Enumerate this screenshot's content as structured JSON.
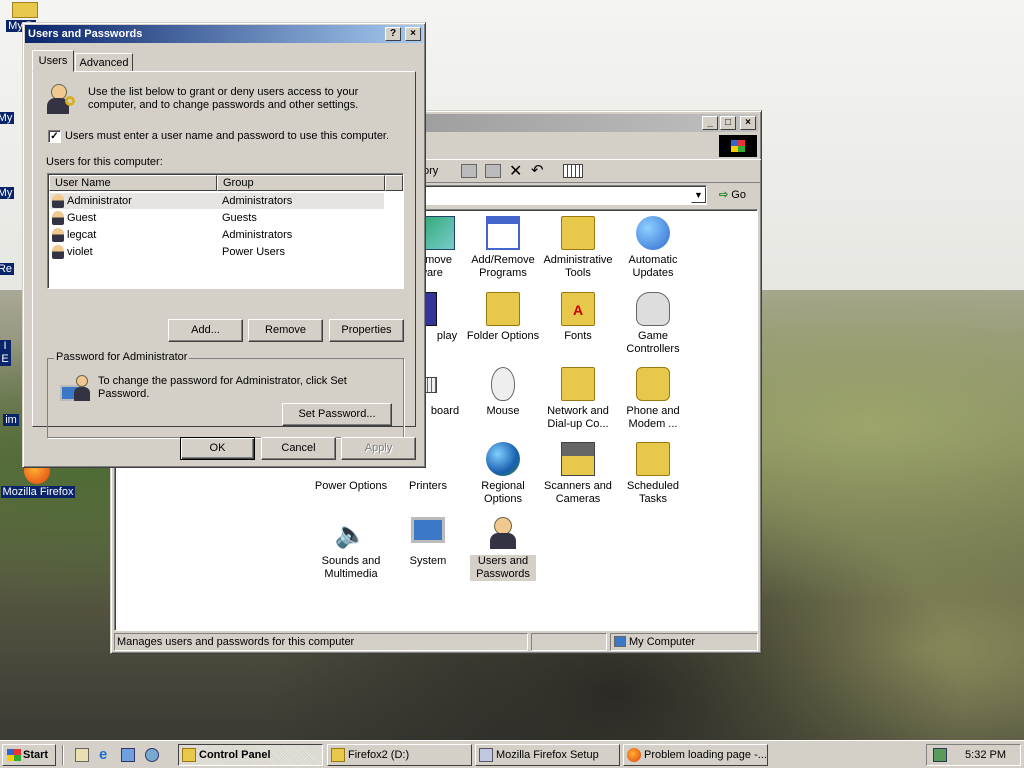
{
  "desktop": {
    "icons": [
      {
        "label": "My D"
      },
      {
        "label": "My"
      },
      {
        "label": "My"
      },
      {
        "label": "Re"
      },
      {
        "label": "I E"
      },
      {
        "label": "im"
      },
      {
        "label": "Mozilla Firefox"
      }
    ]
  },
  "control_panel": {
    "toolbar_history": "ory",
    "go_label": "Go",
    "icons": [
      {
        "label": "emove\nware",
        "color": "#3a7"
      },
      {
        "label": "Add/Remove Programs",
        "color": "#4466cc"
      },
      {
        "label": "Administrative Tools",
        "color": "#e8c84a"
      },
      {
        "label": "Automatic Updates",
        "color": "#2f6ad0"
      },
      {
        "label": "play",
        "color": "#333399"
      },
      {
        "label": "Folder Options",
        "color": "#e8c84a"
      },
      {
        "label": "Fonts",
        "color": "#e8c84a"
      },
      {
        "label": "Game Controllers",
        "color": "#999999"
      },
      {
        "label": "board",
        "color": "#999999"
      },
      {
        "label": "Mouse",
        "color": "#dddddd"
      },
      {
        "label": "Network and Dial-up Co...",
        "color": "#e8c84a"
      },
      {
        "label": "Phone and Modem ...",
        "color": "#e8c84a"
      },
      {
        "label": "Power Options",
        "color": "#e8c84a"
      },
      {
        "label": "Printers",
        "color": "#aaaaaa"
      },
      {
        "label": "Regional Options",
        "color": "#2d8a3e"
      },
      {
        "label": "Scanners and Cameras",
        "color": "#888888"
      },
      {
        "label": "Scheduled Tasks",
        "color": "#e8c84a"
      },
      {
        "label": "Sounds and Multimedia",
        "color": "#cccccc"
      },
      {
        "label": "System",
        "color": "#3c78c8"
      },
      {
        "label": "Users and Passwords",
        "color": "#f0c890"
      }
    ],
    "status_text": "Manages users and passwords for this computer",
    "status_zone": "My Computer"
  },
  "dialog": {
    "title": "Users and Passwords",
    "help_glyph": "?",
    "close_glyph": "×",
    "tabs": [
      "Users",
      "Advanced"
    ],
    "intro_text": "Use the list below to grant or deny users access to your computer, and to change passwords and other settings.",
    "checkbox_label": "Users must enter a user name and password to use this computer.",
    "users_label": "Users for this computer:",
    "columns": [
      "User Name",
      "Group"
    ],
    "users": [
      {
        "name": "Administrator",
        "group": "Administrators"
      },
      {
        "name": "Guest",
        "group": "Guests"
      },
      {
        "name": "legcat",
        "group": "Administrators"
      },
      {
        "name": "violet",
        "group": "Power Users"
      }
    ],
    "add_button": "Add...",
    "remove_button": "Remove",
    "properties_button": "Properties",
    "password_group_title": "Password for Administrator",
    "password_text": "To change the password for Administrator, click Set Password.",
    "set_password_button": "Set Password...",
    "ok_button": "OK",
    "cancel_button": "Cancel",
    "apply_button": "Apply"
  },
  "taskbar": {
    "start_label": "Start",
    "items": [
      "Control Panel",
      "Firefox2 (D:)",
      "Mozilla Firefox Setup",
      "Problem loading page -..."
    ],
    "clock": "5:32 PM"
  }
}
